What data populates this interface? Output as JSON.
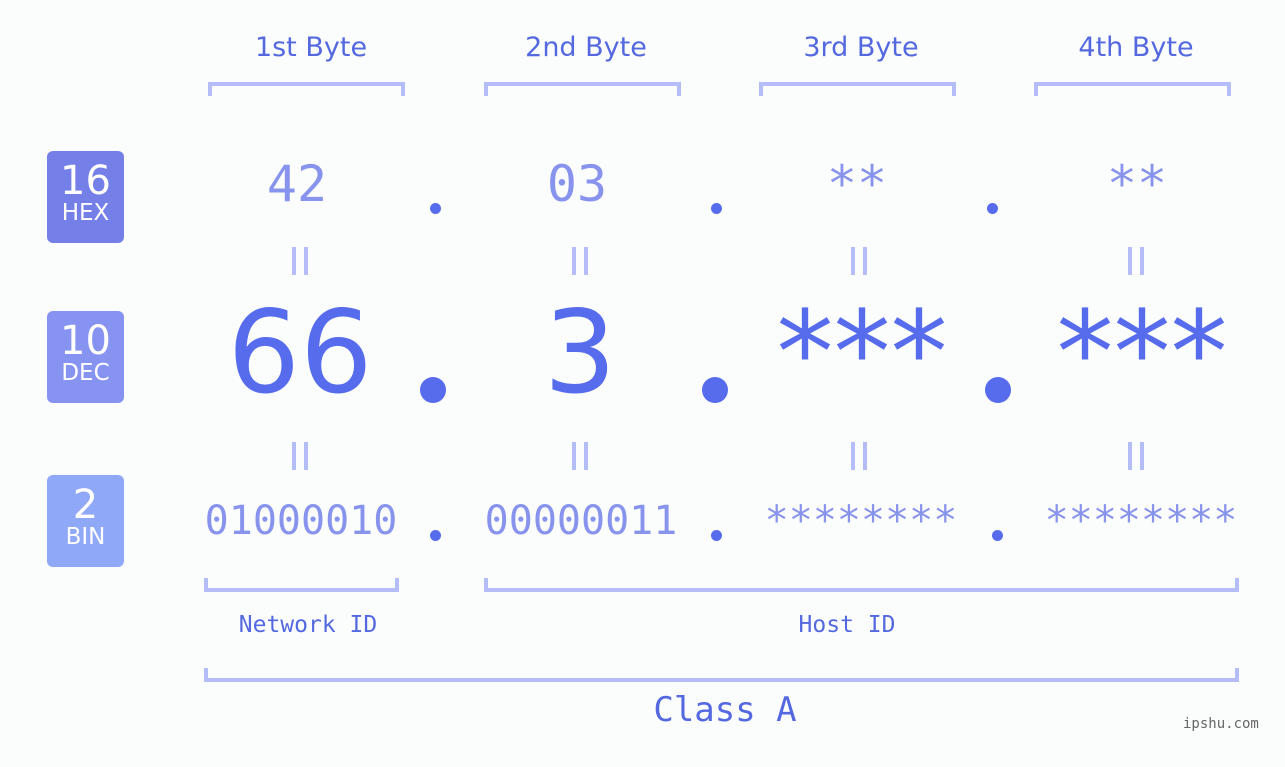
{
  "headers": [
    "1st Byte",
    "2nd Byte",
    "3rd Byte",
    "4th Byte"
  ],
  "badges": {
    "hex": {
      "num": "16",
      "label": "HEX",
      "color": "#7480e8"
    },
    "dec": {
      "num": "10",
      "label": "DEC",
      "color": "#8793f0"
    },
    "bin": {
      "num": "2",
      "label": "BIN",
      "color": "#8fa8f8"
    }
  },
  "hex": [
    "42",
    "03",
    "**",
    "**"
  ],
  "dec": [
    "66",
    "3",
    "***",
    "***"
  ],
  "bin": [
    "01000010",
    "00000011",
    "********",
    "********"
  ],
  "network_label": "Network ID",
  "host_label": "Host ID",
  "class_label": "Class A",
  "watermark": "ipshu.com"
}
